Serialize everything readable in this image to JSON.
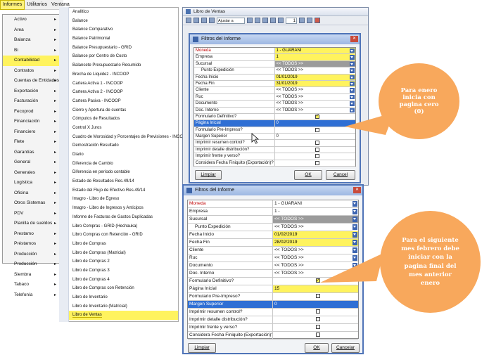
{
  "menubar": {
    "items": [
      "Informes",
      "Utilitarios",
      "Ventana"
    ]
  },
  "submenu": [
    "Activo",
    "Area",
    "Balanza",
    "Bi",
    "Contabilidad",
    "Contratos",
    "Cuentas de Entidades",
    "Exportación",
    "Facturación",
    "Fecoprod",
    "Financiación",
    "Financiero",
    "Flete",
    "Garantías",
    "General",
    "Generales",
    "Logística",
    "Oficina",
    "Otros Sistemas",
    "PDV",
    "Planilla de sueldos",
    "Prestamo",
    "Préstamos",
    "Producción",
    "Producción",
    "Siembra",
    "Tabaco",
    "Telefonía"
  ],
  "submenu_highlight": "Contabilidad",
  "reports": [
    "Analítico",
    "Balance",
    "Balance Comparativo",
    "Balance Patrimonial",
    "Balance Presupuestario - GRID",
    "Balance por Centro de Costo",
    "Balancete Presupuestario Resumido",
    "Brecha de Liquidez - INCOOP",
    "Cartera Activa 1 - INCOOP",
    "Cartera Activa 2 - INCOOP",
    "Cartera Pasiva - INCOOP",
    "Cierre y Apertura de cuentas",
    "Cómputos de Resultados",
    "Control X Juros",
    "Cuadro de Morosidad y Porcentajes de Previsiones - INCOOP",
    "Demostración Resultado",
    "Diario",
    "Diferencia de Cambio",
    "Diferencia en período contable",
    "Estado de Resultados Res.49/14",
    "Estado del Flujo de Efectivo Res.49/14",
    "Imagro - Libro de Egreso",
    "Imagro - Libro de Ingresos y Anticipos",
    "Informe de Facturas de Gastos Duplicadas",
    "Libro Compras - GRID (Hechauka)",
    "Libro Compras con Retención - GRID",
    "Libro de Compras",
    "Libro de Compras (Matricial)",
    "Libro de Compras 2",
    "Libro de Compras 3",
    "Libro de Compras 4",
    "Libro de Compras con Retención",
    "Libro de Inventario",
    "Libro de Inventario (Matricial)",
    "Libro de Ventas"
  ],
  "reports_highlight": "Libro de Ventas",
  "window": {
    "title": "Libro de Ventas",
    "zoom": "Ajustar a",
    "page": "1"
  },
  "dialog1": {
    "title": "Filtros del Informe",
    "rows": [
      {
        "label": "Moneda",
        "value": "1 - GUARANI",
        "dd": true,
        "red": true,
        "hl": true
      },
      {
        "label": "Empresa",
        "value": "1",
        "dd": true,
        "hl": true
      },
      {
        "label": "Sucursal",
        "value": "<< TODOS >>",
        "dd": true,
        "dis": true
      },
      {
        "label": "Punto Expedición",
        "value": "<< TODOS >>",
        "dd": true,
        "indent": true
      },
      {
        "label": "Fecha Inicio",
        "value": "01/01/2019",
        "dd": true,
        "hl": true
      },
      {
        "label": "Fecha Fin",
        "value": "31/01/2019",
        "dd": true,
        "hl": true
      },
      {
        "label": "Cliente",
        "value": "<< TODOS >>",
        "dd": true
      },
      {
        "label": "Ruc",
        "value": "<< TODOS >>",
        "dd": true
      },
      {
        "label": "Documento",
        "value": "<< TODOS >>",
        "dd": true
      },
      {
        "label": "Doc. Interno",
        "value": "<< TODOS >>",
        "dd": true
      },
      {
        "label": "Formulario Definitivo?",
        "value": "",
        "chk": "on"
      },
      {
        "label": "Página Inicial",
        "value": "0",
        "sel": true
      },
      {
        "label": "Formulario Pre-Impreso?",
        "value": "",
        "chk": "off"
      },
      {
        "label": "Margen Superior",
        "value": "0"
      },
      {
        "label": "Imprimir resumen control?",
        "value": "",
        "chk": "off"
      },
      {
        "label": "Imprimir detalle distribución?",
        "value": "",
        "chk": "off"
      },
      {
        "label": "Imprimir frente y verso?",
        "value": "",
        "chk": "off"
      },
      {
        "label": "Considera Fecha Finiquito (Exportación)?",
        "value": "",
        "chk": "off"
      }
    ],
    "clear": "Limpiar",
    "ok": "OK",
    "cancel": "Cancel"
  },
  "dialog2": {
    "title": "Filtros del Informe",
    "rows": [
      {
        "label": "Moneda",
        "value": "1 - GUARANI",
        "dd": true,
        "red": true
      },
      {
        "label": "Empresa",
        "value": "1 -",
        "dd": true
      },
      {
        "label": "Sucursal",
        "value": "<< TODOS >>",
        "dd": true,
        "dis": true
      },
      {
        "label": "Punto Expedición",
        "value": "<< TODOS >>",
        "dd": true,
        "indent": true
      },
      {
        "label": "Fecha Inicio",
        "value": "01/02/2019",
        "dd": true,
        "hl": true
      },
      {
        "label": "Fecha Fin",
        "value": "28/02/2019",
        "dd": true,
        "hl": true
      },
      {
        "label": "Cliente",
        "value": "<< TODOS >>",
        "dd": true
      },
      {
        "label": "Ruc",
        "value": "<< TODOS >>",
        "dd": true
      },
      {
        "label": "Documento",
        "value": "<< TODOS >>",
        "dd": true
      },
      {
        "label": "Doc. Interno",
        "value": "<< TODOS >>",
        "dd": true
      },
      {
        "label": "Formulario Definitivo?",
        "value": "",
        "chk": "on"
      },
      {
        "label": "Página Inicial",
        "value": "15",
        "hl": true
      },
      {
        "label": "Formulario Pre-Impreso?",
        "value": "",
        "chk": "off"
      },
      {
        "label": "Margen Superior",
        "value": "0",
        "sel": true
      },
      {
        "label": "Imprimir resumen control?",
        "value": "",
        "chk": "off"
      },
      {
        "label": "Imprimir detalle distribución?",
        "value": "",
        "chk": "off"
      },
      {
        "label": "Imprimir frente y verso?",
        "value": "",
        "chk": "off"
      },
      {
        "label": "Considera Fecha Finiquito (Exportación)?",
        "value": "",
        "chk": "off"
      }
    ],
    "clear": "Limpiar",
    "ok": "OK",
    "cancel": "Cancelar"
  },
  "callout1": "Para enero inicia con pagina cero (0)",
  "callout2": "Para el siguiente mes febrero debe iniciar con la pagina final del mes anterior enero",
  "colors": {
    "highlight": "#fff35e",
    "selection": "#2f6fd4",
    "callout": "#f8a85c",
    "title": "#9db7e2"
  }
}
